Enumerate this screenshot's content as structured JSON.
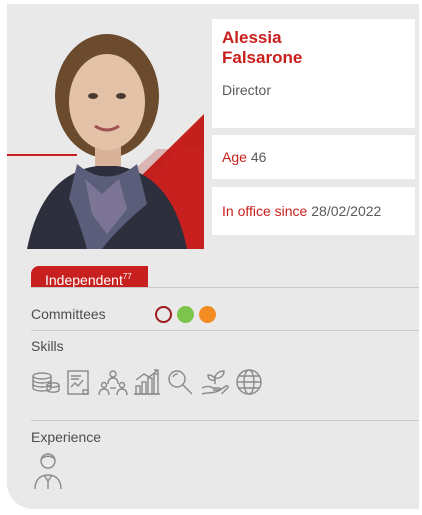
{
  "profile": {
    "first_name": "Alessia",
    "last_name": "Falsarone",
    "role": "Director",
    "age_label": "Age",
    "age_value": "46",
    "office_label": "In office since",
    "office_value": "28/02/2022",
    "independent_label": "Independent",
    "independent_note": "77"
  },
  "sections": {
    "committees_label": "Committees",
    "skills_label": "Skills",
    "experience_label": "Experience"
  },
  "committees": [
    {
      "style": "outline",
      "color": "#9b1b1e"
    },
    {
      "style": "filled",
      "color": "#7cc44b"
    },
    {
      "style": "filled",
      "color": "#f28c22"
    }
  ],
  "skills": [
    "coins-stack-icon",
    "financial-report-icon",
    "team-people-icon",
    "growth-chart-icon",
    "magnifier-icon",
    "plant-hand-icon",
    "globe-icon"
  ],
  "experience": [
    "person-avatar-icon"
  ],
  "colors": {
    "accent": "#c8201e",
    "card_bg": "#e9e9e9",
    "text": "#5a5a5a",
    "icon": "#8a8a8a"
  }
}
